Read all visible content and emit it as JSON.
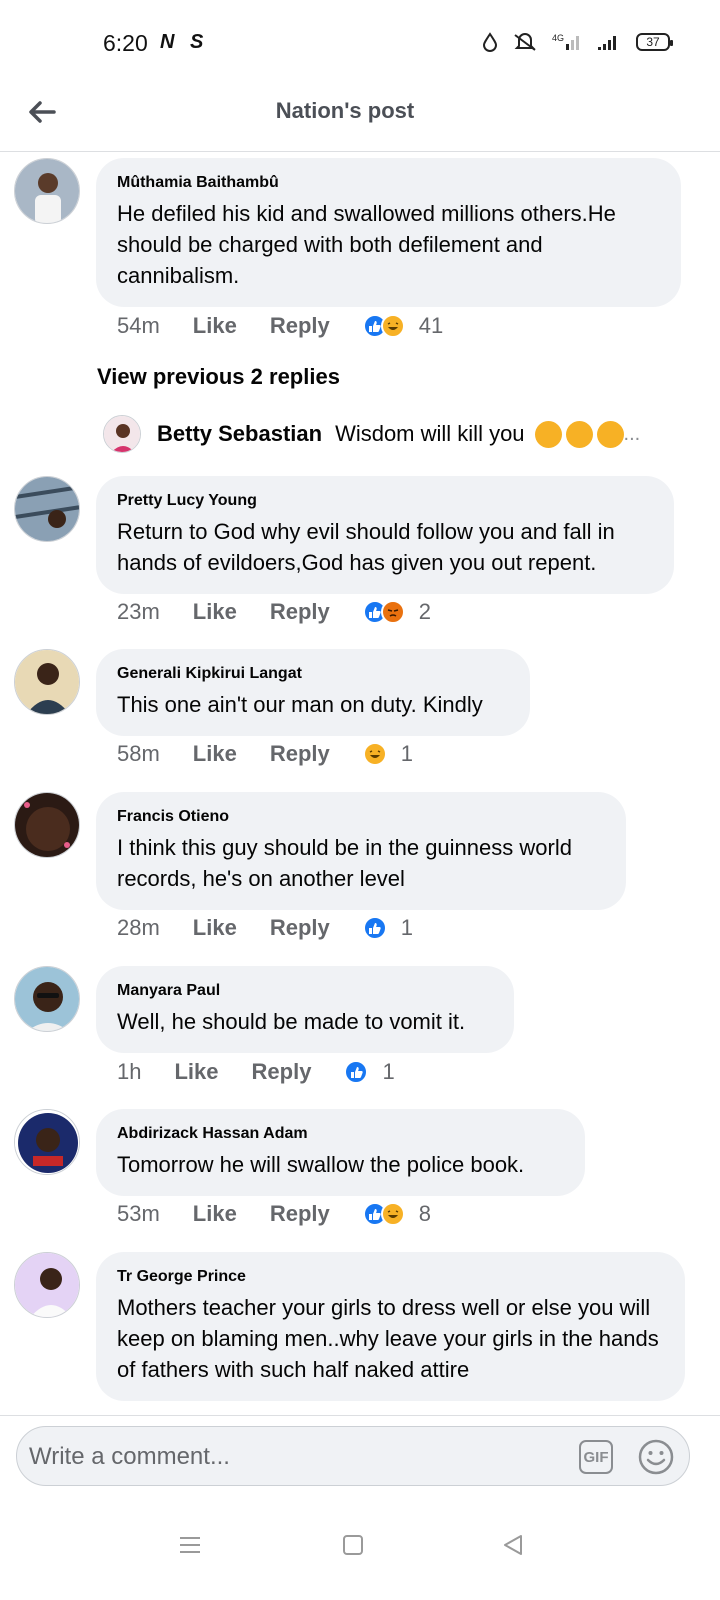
{
  "status_bar": {
    "time": "6:20",
    "app_icons": [
      "N",
      "S"
    ],
    "network": "4G",
    "battery": "37"
  },
  "header": {
    "title": "Nation's post"
  },
  "comments": [
    {
      "author": "Mûthamia Baithambû",
      "text": "He defiled his kid and swallowed millions others.He should be charged with both defilement and cannibalism.",
      "time": "54m",
      "like_label": "Like",
      "reply_label": "Reply",
      "reaction_count": "41"
    },
    {
      "author": "Pretty Lucy Young",
      "text": "Return to God why evil should follow you and fall in hands of evildoers,God has given you out repent.",
      "time": "23m",
      "like_label": "Like",
      "reply_label": "Reply",
      "reaction_count": "2"
    },
    {
      "author": "Generali Kipkirui Langat",
      "text": "This one ain't our man on duty. Kindly",
      "time": "58m",
      "like_label": "Like",
      "reply_label": "Reply",
      "reaction_count": "1"
    },
    {
      "author": "Francis Otieno",
      "text": "I think this guy should be in the guinness world records, he's on another level",
      "time": "28m",
      "like_label": "Like",
      "reply_label": "Reply",
      "reaction_count": "1"
    },
    {
      "author": "Manyara Paul",
      "text": "Well, he should be made to vomit it.",
      "time": "1h",
      "like_label": "Like",
      "reply_label": "Reply",
      "reaction_count": "1"
    },
    {
      "author": "Abdirizack Hassan Adam",
      "text": "Tomorrow he will swallow the police book.",
      "time": "53m",
      "like_label": "Like",
      "reply_label": "Reply",
      "reaction_count": "8"
    },
    {
      "author": "Tr George Prince",
      "text": "Mothers teacher your girls to dress well or else you will keep on blaming men..why leave your girls in the hands of fathers with such half naked attire",
      "time": "",
      "like_label": "",
      "reply_label": "",
      "reaction_count": ""
    }
  ],
  "replies_thread": {
    "view_previous_label": "View previous 2 replies",
    "reply_author": "Betty Sebastian",
    "reply_text": "Wisdom will kill you",
    "ellipsis": "..."
  },
  "composer": {
    "placeholder": "Write a comment...",
    "gif_label": "GIF"
  },
  "colors": {
    "bubble_bg": "#f0f2f5",
    "like_blue": "#1877f2",
    "haha_yellow": "#f7b125",
    "angry_orange": "#e9710f",
    "meta_gray": "#65676b"
  },
  "icons": [
    "back-arrow-icon",
    "like-reaction-icon",
    "haha-reaction-icon",
    "angry-reaction-icon",
    "gif-icon",
    "emoji-icon",
    "menu-icon",
    "home-square-icon",
    "back-triangle-icon"
  ]
}
